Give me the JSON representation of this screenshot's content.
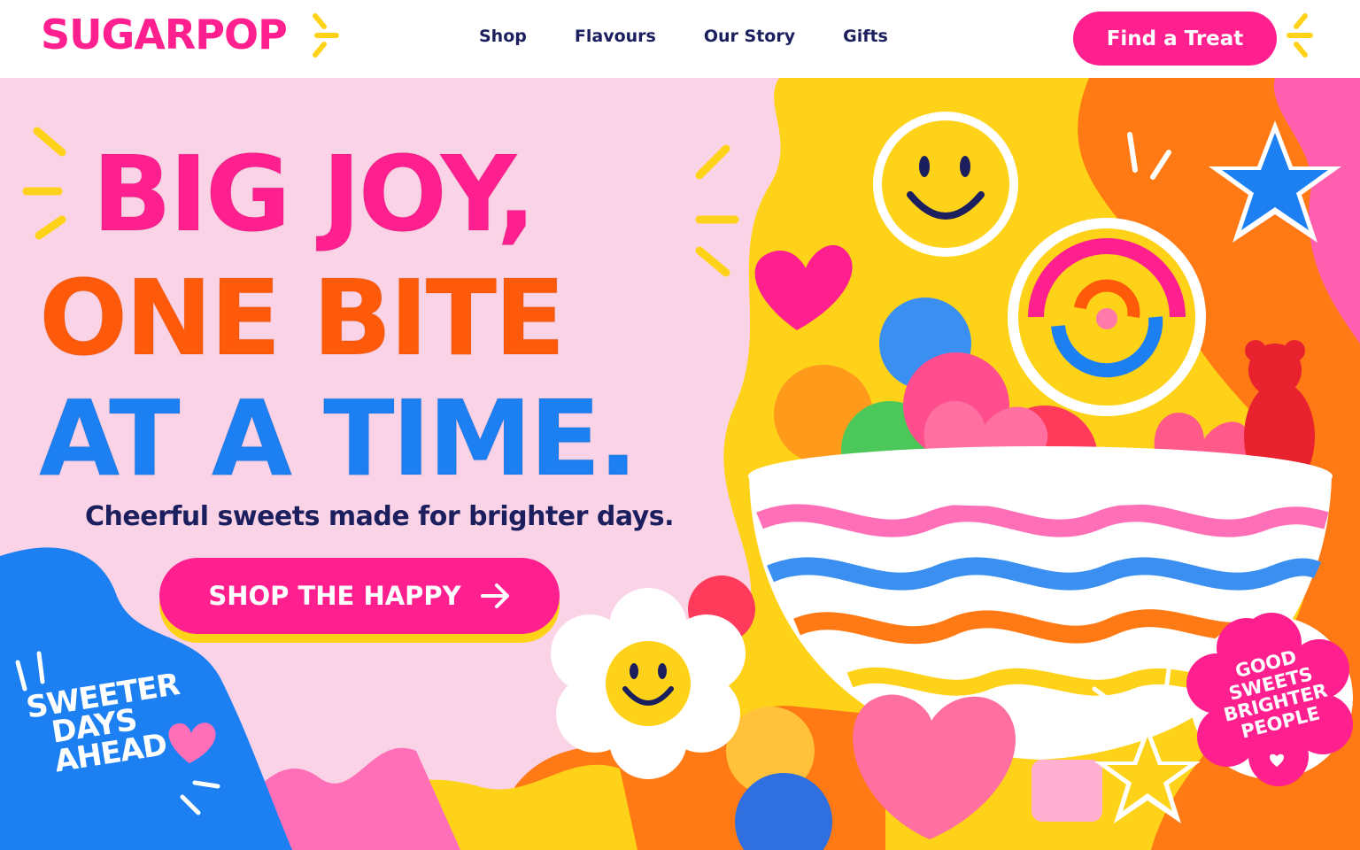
{
  "brand": {
    "name": "SUGARPOP"
  },
  "nav": {
    "links": [
      {
        "label": "Shop"
      },
      {
        "label": "Flavours"
      },
      {
        "label": "Our Story"
      },
      {
        "label": "Gifts"
      }
    ],
    "cta_label": "Find a Treat"
  },
  "hero": {
    "headline_lines": [
      "BIG JOY,",
      "ONE BITE",
      "AT A TIME."
    ],
    "subheadline": "Cheerful sweets made for brighter days.",
    "cta_label": "SHOP THE HAPPY",
    "cta_icon": "arrow-right-icon"
  },
  "stickers": {
    "left_lines": [
      "SWEETER",
      "DAYS",
      "AHEAD"
    ],
    "badge_lines": [
      "GOOD",
      "SWEETS",
      "BRIGHTER",
      "PEOPLE"
    ]
  },
  "colors": {
    "pink": "#ff1f8e",
    "orange": "#ff5a0a",
    "blue": "#1c7ff2",
    "yellow": "#ffd21a",
    "navy": "#1b1f5e",
    "bg_pink": "#fbd3e6"
  },
  "icons": [
    "sparkle-icon",
    "smiley-icon",
    "heart-icon",
    "star-icon",
    "daisy-smiley-icon",
    "lollipop-icon",
    "arrow-right-icon"
  ]
}
